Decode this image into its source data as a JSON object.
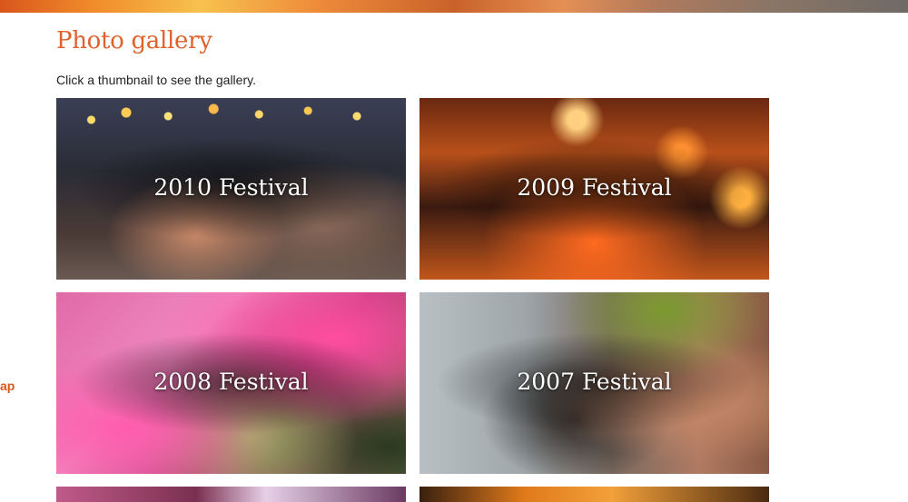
{
  "page": {
    "title": "Photo gallery",
    "intro": "Click a thumbnail to see the gallery.",
    "side_link_fragment": "ap"
  },
  "gallery": {
    "items": [
      {
        "label": "2010 Festival"
      },
      {
        "label": "2009 Festival"
      },
      {
        "label": "2008 Festival"
      },
      {
        "label": "2007 Festival"
      }
    ]
  },
  "colors": {
    "accent": "#e0622a",
    "text": "#222222",
    "background": "#ffffff"
  }
}
